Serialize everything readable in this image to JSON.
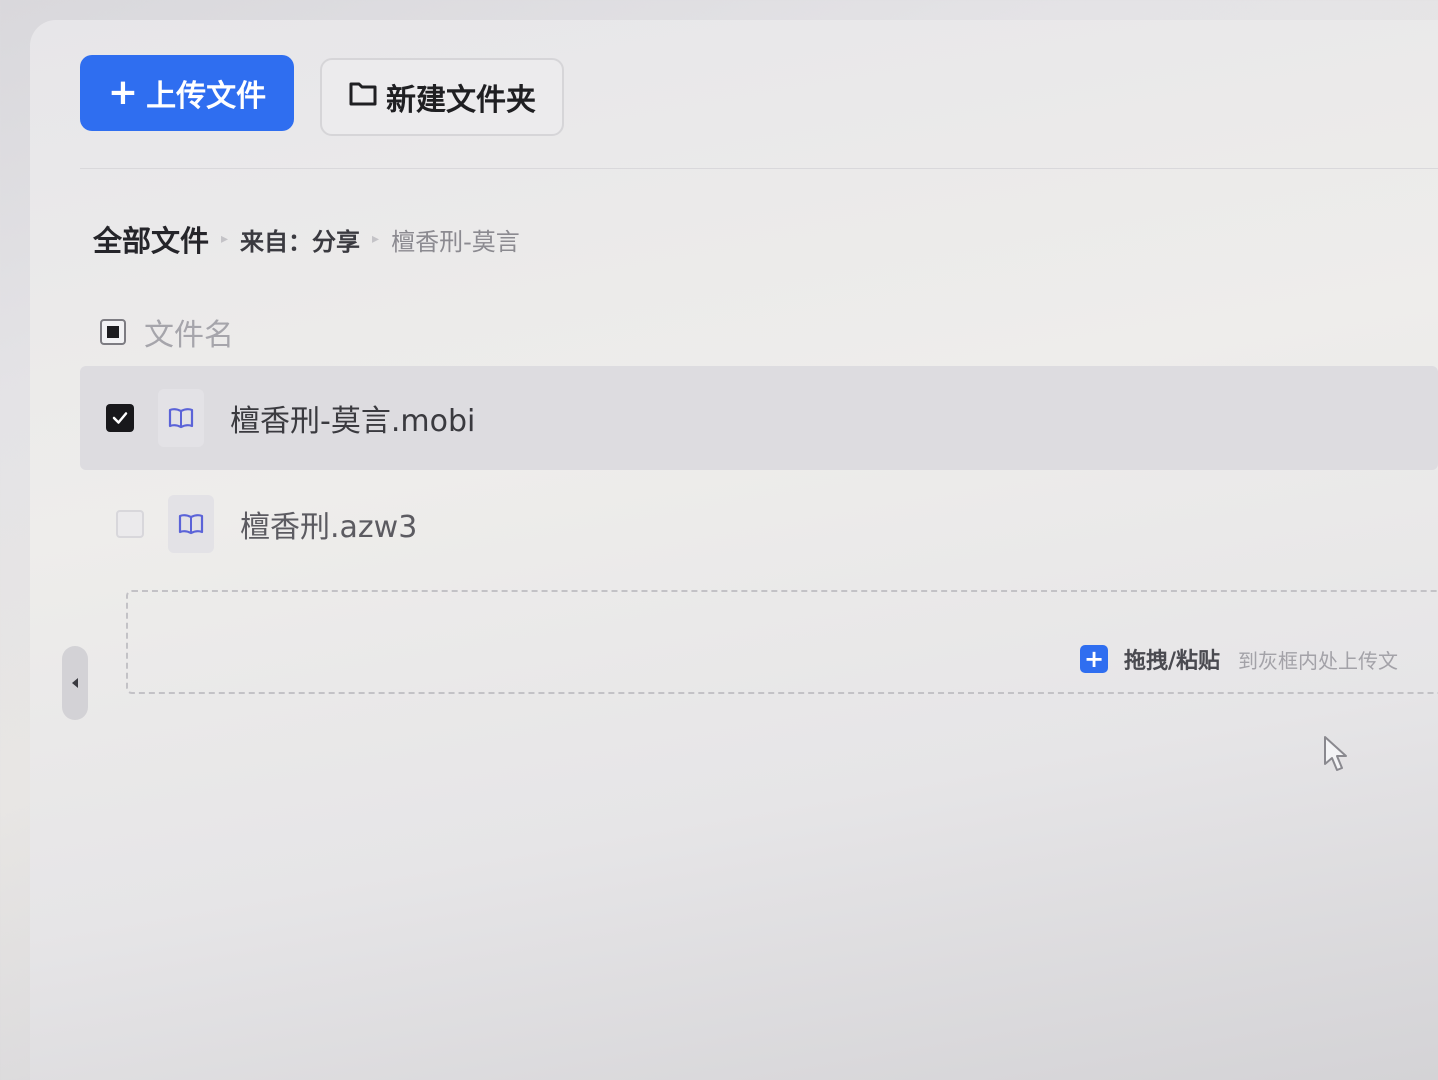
{
  "toolbar": {
    "upload_label": "上传文件",
    "upload_icon": "plus-icon",
    "new_folder_label": "新建文件夹",
    "new_folder_icon": "folder-icon"
  },
  "breadcrumb": {
    "root": "全部文件",
    "middle": "来自：分享",
    "current": "檀香刑-莫言"
  },
  "file_list": {
    "column_header": "文件名",
    "rows": [
      {
        "name": "檀香刑-莫言.mobi",
        "checked": true,
        "icon": "book-icon"
      },
      {
        "name": "檀香刑.azw3",
        "checked": false,
        "icon": "book-icon"
      }
    ]
  },
  "dropzone": {
    "strong_text": "拖拽/粘贴",
    "note_text": "到灰框内处上传文"
  },
  "colors": {
    "accent": "#2f6ef0",
    "icon": "#5b63d8",
    "text_dark": "#25252a",
    "text_muted": "#8b8a90"
  }
}
